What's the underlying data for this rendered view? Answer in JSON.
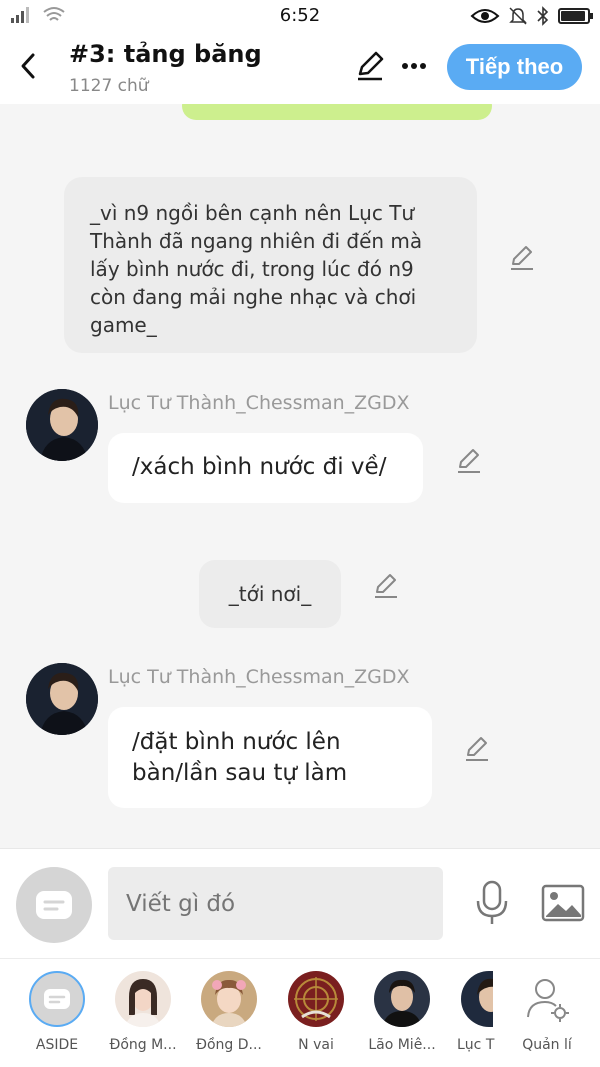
{
  "status_bar": {
    "time": "6:52"
  },
  "header": {
    "title": "#3: tảng băng",
    "subtitle": "1127 chữ",
    "next_label": "Tiếp theo"
  },
  "messages": [
    {
      "type": "narration",
      "text": "_vì n9 ngồi bên cạnh nên Lục Tư Thành đã ngang nhiên đi đến mà lấy bình nước đi, trong lúc đó n9 còn đang mải nghe nhạc và chơi game_"
    },
    {
      "type": "character",
      "sender": "Lục Tư Thành_Chessman_ZGDX",
      "text": "/xách bình nước đi về/"
    },
    {
      "type": "narration",
      "text": "_tới nơi_"
    },
    {
      "type": "character",
      "sender": "Lục Tư Thành_Chessman_ZGDX",
      "text": "/đặt bình nước lên bàn/lần sau tự làm"
    }
  ],
  "input": {
    "placeholder": "Viết gì đó"
  },
  "characters": [
    {
      "label": "ASIDE",
      "color": "#d5d5d5"
    },
    {
      "label": "Đồng M...",
      "color": "#e8cfc4"
    },
    {
      "label": "Đồng D...",
      "color": "#c9a97f"
    },
    {
      "label": "N vai",
      "color": "#7a1f1f"
    },
    {
      "label": "Lão Miê...",
      "color": "#2a3344"
    },
    {
      "label": "Lục T",
      "color": "#1f2a3d"
    },
    {
      "label": "Quản lí",
      "color": "#ffffff"
    }
  ]
}
